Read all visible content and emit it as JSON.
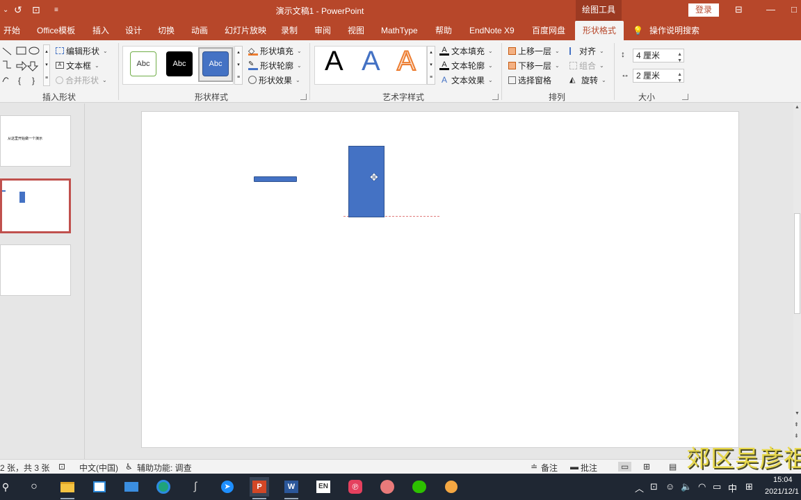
{
  "titlebar": {
    "doc_title": "演示文稿1  -  PowerPoint",
    "context_tab_title": "绘图工具",
    "login_label": "登录"
  },
  "tabs": [
    {
      "label": "开始"
    },
    {
      "label": "Office模板"
    },
    {
      "label": "插入"
    },
    {
      "label": "设计"
    },
    {
      "label": "切换"
    },
    {
      "label": "动画"
    },
    {
      "label": "幻灯片放映"
    },
    {
      "label": "录制"
    },
    {
      "label": "审阅"
    },
    {
      "label": "视图"
    },
    {
      "label": "MathType"
    },
    {
      "label": "帮助"
    },
    {
      "label": "EndNote X9"
    },
    {
      "label": "百度网盘"
    },
    {
      "label": "形状格式",
      "active": true
    },
    {
      "label": "操作说明搜索"
    }
  ],
  "ribbon": {
    "insert_shapes": {
      "edit_shape": "编辑形状",
      "text_box": "文本框",
      "merge_shapes": "合并形状",
      "group_label": "插入形状"
    },
    "shape_styles": {
      "samples": [
        "Abc",
        "Abc",
        "Abc"
      ],
      "fill": "形状填充",
      "outline": "形状轮廓",
      "effects": "形状效果",
      "group_label": "形状样式"
    },
    "wordart": {
      "samples": [
        "A",
        "A",
        "A"
      ],
      "text_fill": "文本填充",
      "text_outline": "文本轮廓",
      "text_effects": "文本效果",
      "group_label": "艺术字样式"
    },
    "arrange": {
      "bring_forward": "上移一层",
      "send_backward": "下移一层",
      "selection_pane": "选择窗格",
      "align": "对齐",
      "group": "组合",
      "rotate": "旋转",
      "group_label": "排列"
    },
    "size": {
      "height": "4 厘米",
      "width": "2 厘米",
      "group_label": "大小"
    }
  },
  "thumbnails": {
    "slide1_text": "从这里开始做一个演示"
  },
  "statusbar": {
    "slide_count": "2 张，共 3 张",
    "language": "中文(中国)",
    "accessibility": "辅助功能: 调查",
    "notes": "备注",
    "comments": "批注"
  },
  "taskbar": {
    "time": "15:04",
    "date": "2021/12/1",
    "ime_lang": "中",
    "en_app_label": "EN"
  },
  "watermark": "郊区吴彦祖",
  "colors": {
    "accent": "#b7472a",
    "shape_fill": "#4472c4",
    "selected_thumb_border": "#c0504d"
  }
}
